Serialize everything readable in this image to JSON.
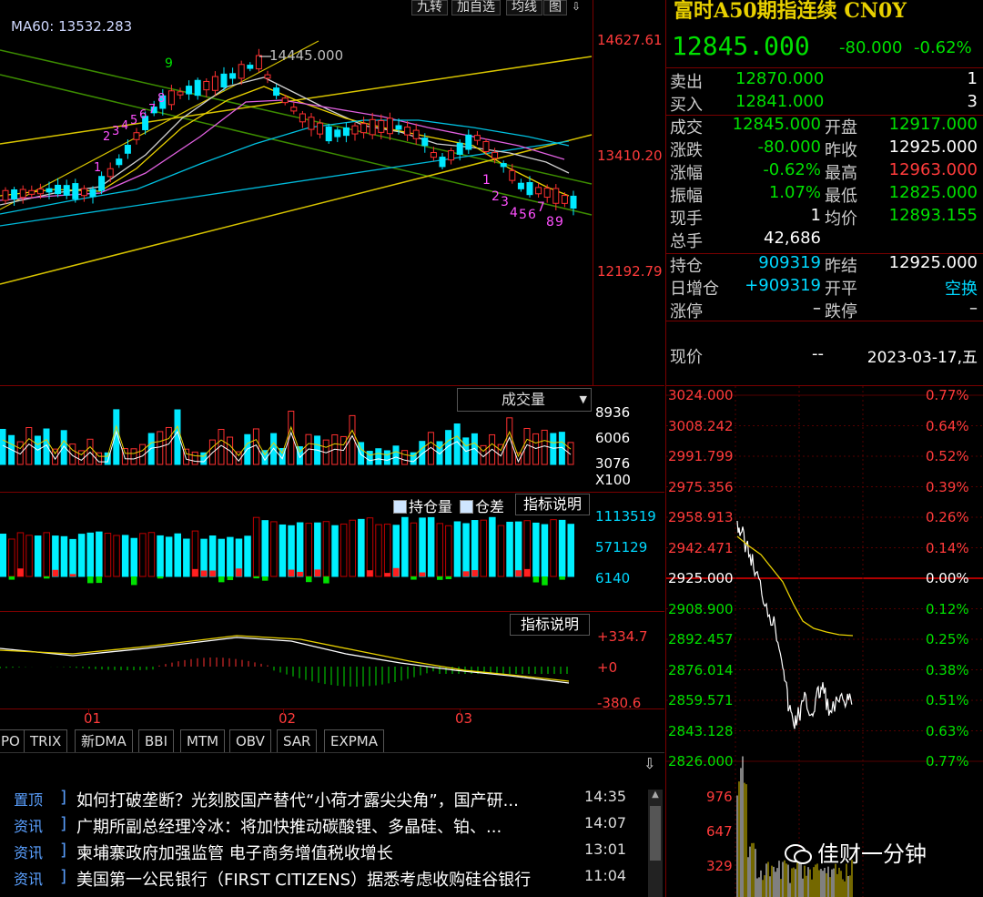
{
  "toolbar": {
    "tabs": [
      "九转",
      "加自选",
      "均线",
      "图"
    ]
  },
  "kline": {
    "ma_label": "MA60: 13532.283",
    "peak_label": "14445.000",
    "price_ticks": [
      "14627.61",
      "13410.20",
      "12192.79"
    ],
    "setup_marks": [
      "1",
      "2",
      "3",
      "4",
      "5",
      "6",
      "7",
      "8",
      "9"
    ]
  },
  "volume_panel": {
    "dropdown": "成交量",
    "ticks": [
      "8936",
      "6006",
      "3076",
      "X100"
    ]
  },
  "oi_panel": {
    "check1": "持仓量",
    "check2": "仓差",
    "explain": "指标说明",
    "ticks": [
      "1113519",
      "571129",
      "6140"
    ]
  },
  "macd_panel": {
    "explain": "指标说明",
    "ticks": [
      "+334.7",
      "+0",
      "-380.6"
    ]
  },
  "months": [
    "01",
    "02",
    "03"
  ],
  "indicator_tabs": [
    "PO",
    "TRIX",
    "新DMA",
    "BBI",
    "MTM",
    "OBV",
    "SAR",
    "EXPMA"
  ],
  "quote": {
    "title": "富时A50期指连续 CN0Y",
    "last": "12845.000",
    "chg": "-80.000",
    "pct": "-0.62%",
    "ask_label": "卖出",
    "ask": "12870.000",
    "ask_vol": "1",
    "bid_label": "买入",
    "bid": "12841.000",
    "bid_vol": "3",
    "rows": [
      {
        "l1": "成交",
        "v1": "12845.000",
        "l2": "开盘",
        "v2": "12917.000"
      },
      {
        "l1": "涨跌",
        "v1": "-80.000",
        "l2": "昨收",
        "v2": "12925.000"
      },
      {
        "l1": "涨幅",
        "v1": "-0.62%",
        "l2": "最高",
        "v2": "12963.000"
      },
      {
        "l1": "振幅",
        "v1": "1.07%",
        "l2": "最低",
        "v2": "12825.000"
      },
      {
        "l1": "现手",
        "v1": "1",
        "l2": "均价",
        "v2": "12893.155"
      },
      {
        "l1": "总手",
        "v1": "42,686",
        "l2": "",
        "v2": ""
      }
    ],
    "rows2": [
      {
        "l1": "持仓",
        "v1": "909319",
        "l2": "昨结",
        "v2": "12925.000"
      },
      {
        "l1": "日增仓",
        "v1": "+909319",
        "l2": "开平",
        "v2": "空换"
      },
      {
        "l1": "涨停",
        "v1": "–",
        "l2": "跌停",
        "v2": "–"
      }
    ],
    "now_label": "现价",
    "now_val": "--",
    "date": "2023-03-17,五"
  },
  "intraday": {
    "left_ticks": [
      "3024.000",
      "3008.242",
      "2991.799",
      "2975.356",
      "2958.913",
      "2942.471",
      "2925.000",
      "2908.900",
      "2892.457",
      "2876.014",
      "2859.571",
      "2843.128",
      "2826.000"
    ],
    "right_ticks": [
      "0.77%",
      "0.64%",
      "0.52%",
      "0.39%",
      "0.26%",
      "0.14%",
      "0.00%",
      "0.12%",
      "0.25%",
      "0.38%",
      "0.51%",
      "0.63%",
      "0.77%"
    ],
    "vol_ticks": [
      "976",
      "647",
      "329"
    ]
  },
  "news": [
    {
      "tag": "置顶",
      "title": "如何打破垄断？光刻胶国产替代“小荷才露尖尖角”，国产研...",
      "time": "14:35"
    },
    {
      "tag": "资讯",
      "title": "广期所副总经理冷冰：将加快推动碳酸锂、多晶硅、铂、...",
      "time": "14:07"
    },
    {
      "tag": "资讯",
      "title": "柬埔寨政府加强监管 电子商务增值税收增长",
      "time": "13:01"
    },
    {
      "tag": "资讯",
      "title": "美国第一公民银行（FIRST CITIZENS）据悉考虑收购硅谷银行",
      "time": "11:04"
    }
  ],
  "watermark": "佳财一分钟"
}
